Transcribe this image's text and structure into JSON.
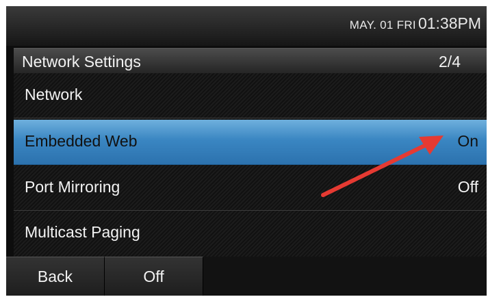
{
  "status": {
    "date": "MAY. 01 FRI",
    "time": "01:38PM"
  },
  "header": {
    "title": "Network Settings",
    "page": "2/4"
  },
  "menu": {
    "items": [
      {
        "label": "Network",
        "value": ""
      },
      {
        "label": "Embedded Web",
        "value": "On",
        "selected": true
      },
      {
        "label": "Port Mirroring",
        "value": "Off"
      },
      {
        "label": "Multicast Paging",
        "value": ""
      }
    ]
  },
  "softkeys": {
    "back": "Back",
    "toggle": "Off"
  },
  "colors": {
    "highlight": "#3a86c2",
    "arrow": "#e53a32"
  },
  "icons": {
    "annotation": "red-arrow-icon"
  }
}
